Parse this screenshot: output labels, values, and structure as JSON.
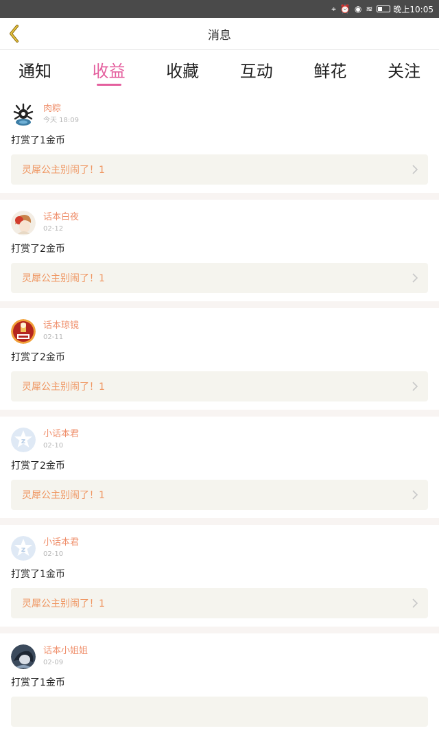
{
  "status_bar": {
    "time": "晚上10:05"
  },
  "header": {
    "title": "消息"
  },
  "tabs": [
    {
      "label": "通知",
      "active": false
    },
    {
      "label": "收益",
      "active": true
    },
    {
      "label": "收藏",
      "active": false
    },
    {
      "label": "互动",
      "active": false
    },
    {
      "label": "鲜花",
      "active": false
    },
    {
      "label": "关注",
      "active": false
    }
  ],
  "messages": [
    {
      "user": "肉粽",
      "date": "今天 18:09",
      "text": "打赏了1金币",
      "story": "灵犀公主别闹了！1",
      "avatar": "dark-gear-avatar"
    },
    {
      "user": "话本白夜",
      "date": "02-12",
      "text": "打赏了2金币",
      "story": "灵犀公主别闹了！1",
      "avatar": "anime-girl-avatar"
    },
    {
      "user": "话本琼镜",
      "date": "02-11",
      "text": "打赏了2金币",
      "story": "灵犀公主别闹了！1",
      "avatar": "red-badge-avatar"
    },
    {
      "user": "小话本君",
      "date": "02-10",
      "text": "打赏了2金币",
      "story": "灵犀公主别闹了！1",
      "avatar": "z-star-avatar"
    },
    {
      "user": "小话本君",
      "date": "02-10",
      "text": "打赏了1金币",
      "story": "灵犀公主别闹了！1",
      "avatar": "z-star-avatar"
    },
    {
      "user": "话本小姐姐",
      "date": "02-09",
      "text": "打赏了1金币",
      "story": "",
      "avatar": "dark-photo-avatar"
    }
  ],
  "colors": {
    "accent": "#e45f9e",
    "username": "#ef8e6a",
    "story": "#ef9560",
    "statusbar": "#4a4a4a"
  }
}
